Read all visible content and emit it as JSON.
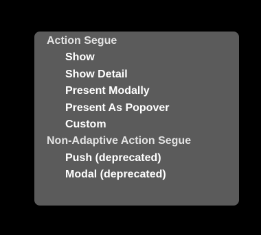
{
  "menu": {
    "sections": [
      {
        "header": "Action Segue",
        "items": [
          "Show",
          "Show Detail",
          "Present Modally",
          "Present As Popover",
          "Custom"
        ]
      },
      {
        "header": "Non-Adaptive Action Segue",
        "items": [
          "Push (deprecated)",
          "Modal (deprecated)"
        ]
      }
    ]
  }
}
